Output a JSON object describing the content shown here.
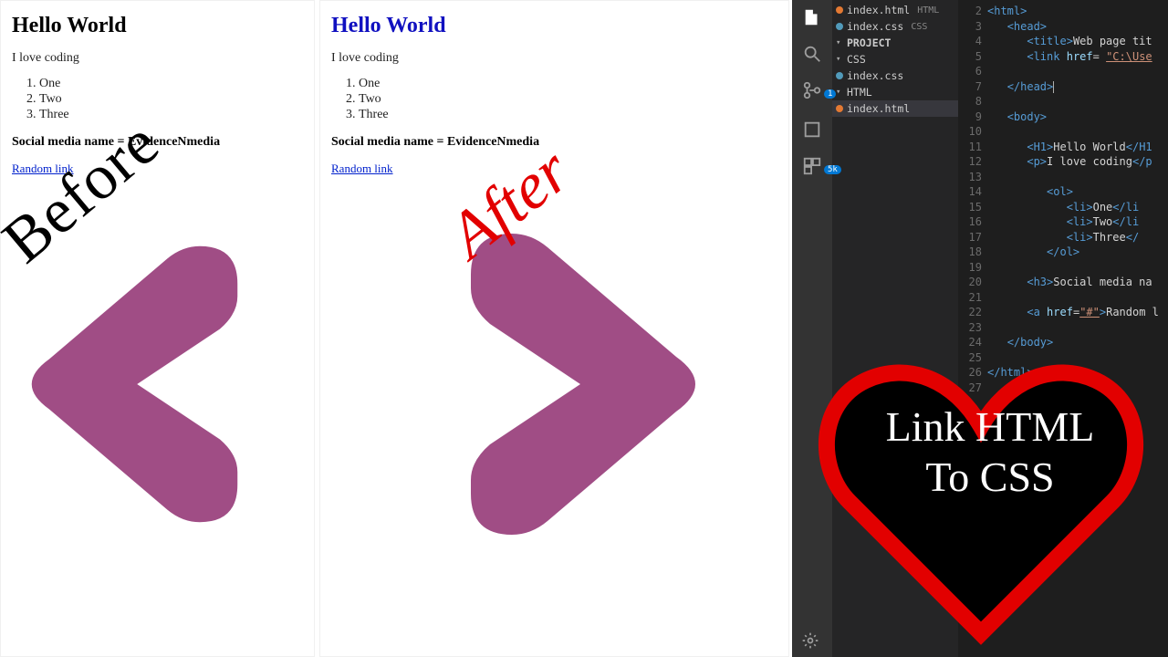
{
  "page": {
    "heading": "Hello World",
    "paragraph": "I love coding",
    "list": [
      "One",
      "Two",
      "Three"
    ],
    "subheading": "Social media name = EvidenceNmedia",
    "link_text": "Random link"
  },
  "labels": {
    "before": "Before",
    "after": "After"
  },
  "heart_text": "Link HTML To CSS",
  "editor": {
    "tabs": [
      {
        "name": "index.html",
        "lang": "HTML"
      },
      {
        "name": "index.css",
        "lang": "CSS"
      }
    ],
    "explorer": {
      "section": "PROJECT",
      "tree": [
        {
          "type": "folder",
          "name": "CSS",
          "open": true,
          "children": [
            {
              "type": "file",
              "name": "index.css",
              "kind": "css"
            }
          ]
        },
        {
          "type": "folder",
          "name": "HTML",
          "open": true,
          "children": [
            {
              "type": "file",
              "name": "index.html",
              "kind": "html",
              "selected": true
            }
          ]
        }
      ]
    },
    "code_lines": [
      {
        "n": 2,
        "html": "<span class='t-tag'>&lt;html&gt;</span>"
      },
      {
        "n": 3,
        "html": "   <span class='t-tag'>&lt;head&gt;</span>"
      },
      {
        "n": 4,
        "html": "      <span class='t-tag'>&lt;title&gt;</span><span class='t-text'>Web page tit</span>"
      },
      {
        "n": 5,
        "html": "      <span class='t-tag'>&lt;link</span> <span class='t-attr'>href</span>= <span class='t-str'>\"C:\\Use</span>"
      },
      {
        "n": 6,
        "html": ""
      },
      {
        "n": 7,
        "html": "   <span class='t-tag'>&lt;/head&gt;</span><span class='cur'></span>"
      },
      {
        "n": 8,
        "html": ""
      },
      {
        "n": 9,
        "html": "   <span class='t-tag'>&lt;body&gt;</span>"
      },
      {
        "n": 10,
        "html": ""
      },
      {
        "n": 11,
        "html": "      <span class='t-tag'>&lt;H1&gt;</span><span class='t-text'>Hello World</span><span class='t-tag'>&lt;/H1</span>"
      },
      {
        "n": 12,
        "html": "      <span class='t-tag'>&lt;p&gt;</span><span class='t-text'>I love coding</span><span class='t-tag'>&lt;/p</span>"
      },
      {
        "n": 13,
        "html": ""
      },
      {
        "n": 14,
        "html": "         <span class='t-tag'>&lt;ol&gt;</span>"
      },
      {
        "n": 15,
        "html": "            <span class='t-tag'>&lt;li&gt;</span><span class='t-text'>One</span><span class='t-tag'>&lt;/li</span>"
      },
      {
        "n": 16,
        "html": "            <span class='t-tag'>&lt;li&gt;</span><span class='t-text'>Two</span><span class='t-tag'>&lt;/li</span>"
      },
      {
        "n": 17,
        "html": "            <span class='t-tag'>&lt;li&gt;</span><span class='t-text'>Three</span><span class='t-tag'>&lt;/</span>"
      },
      {
        "n": 18,
        "html": "         <span class='t-tag'>&lt;/ol&gt;</span>"
      },
      {
        "n": 19,
        "html": ""
      },
      {
        "n": 20,
        "html": "      <span class='t-tag'>&lt;h3&gt;</span><span class='t-text'>Social media na</span>"
      },
      {
        "n": 21,
        "html": ""
      },
      {
        "n": 22,
        "html": "      <span class='t-tag'>&lt;a</span> <span class='t-attr'>href</span>=<span class='t-str'>\"#\"</span><span class='t-tag'>&gt;</span><span class='t-text'>Random l</span>"
      },
      {
        "n": 23,
        "html": ""
      },
      {
        "n": 24,
        "html": "   <span class='t-tag'>&lt;/body&gt;</span>"
      },
      {
        "n": 25,
        "html": ""
      },
      {
        "n": 26,
        "html": "<span class='t-tag'>&lt;/html&gt;</span>"
      },
      {
        "n": 27,
        "html": ""
      }
    ],
    "activity_badges": {
      "scm": "1",
      "ext": "5k"
    }
  },
  "colors": {
    "chevron": "#a04d85",
    "after_red": "#e20000",
    "heading_blue": "#1010c0"
  }
}
